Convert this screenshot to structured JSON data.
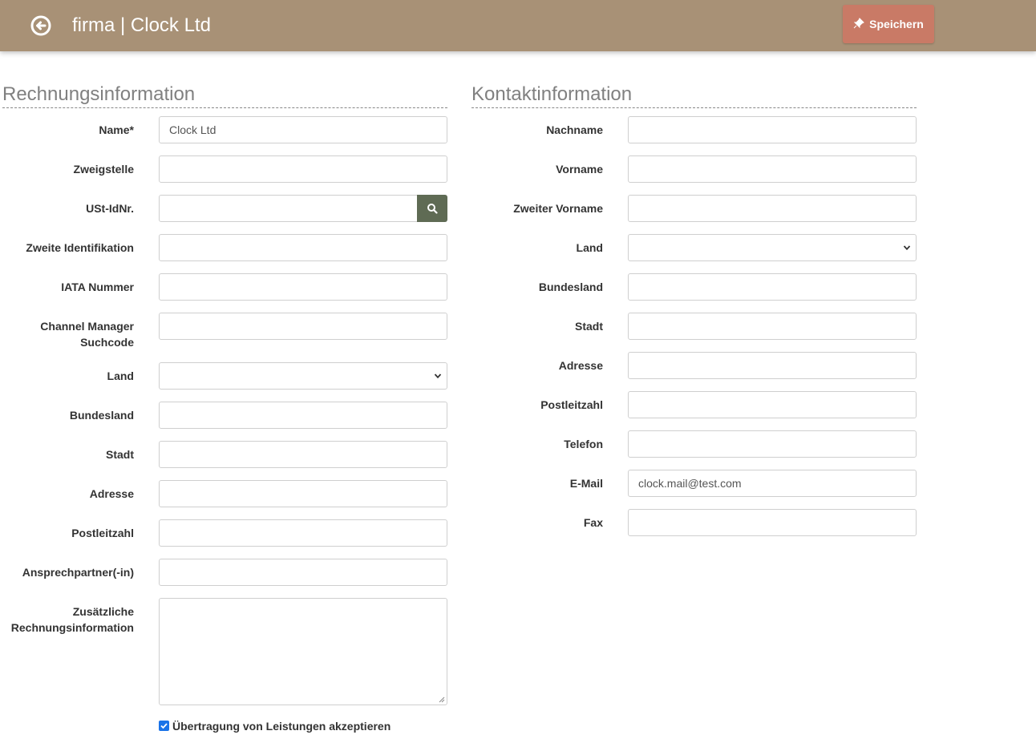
{
  "header": {
    "title": "firma | Clock Ltd",
    "save_label": "Speichern"
  },
  "billing": {
    "section_title": "Rechnungsinformation",
    "name_label": "Name*",
    "name_value": "Clock Ltd",
    "branch_label": "Zweigstelle",
    "vat_label": "USt-IdNr.",
    "second_id_label": "Zweite Identifikation",
    "iata_label": "IATA Nummer",
    "channel_label_line1": "Channel Manager",
    "channel_label_line2": "Suchcode",
    "country_label": "Land",
    "state_label": "Bundesland",
    "city_label": "Stadt",
    "address_label": "Adresse",
    "zip_label": "Postleitzahl",
    "contact_person_label": "Ansprechpartner(-in)",
    "extra_info_label_line1": "Zusätzliche",
    "extra_info_label_line2": "Rechnungsinformation",
    "accept_transfer_label": "Übertragung von Leistungen akzeptieren",
    "accept_transfer_checked": true
  },
  "contact": {
    "section_title": "Kontaktinformation",
    "lastname_label": "Nachname",
    "firstname_label": "Vorname",
    "middlename_label": "Zweiter Vorname",
    "country_label": "Land",
    "state_label": "Bundesland",
    "city_label": "Stadt",
    "address_label": "Adresse",
    "zip_label": "Postleitzahl",
    "phone_label": "Telefon",
    "email_label": "E-Mail",
    "email_value": "clock.mail@test.com",
    "fax_label": "Fax"
  },
  "colors": {
    "header_bg": "#a89176",
    "save_button": "#c97a66",
    "search_button": "#5f6b54",
    "checkbox": "#1a73e8"
  }
}
